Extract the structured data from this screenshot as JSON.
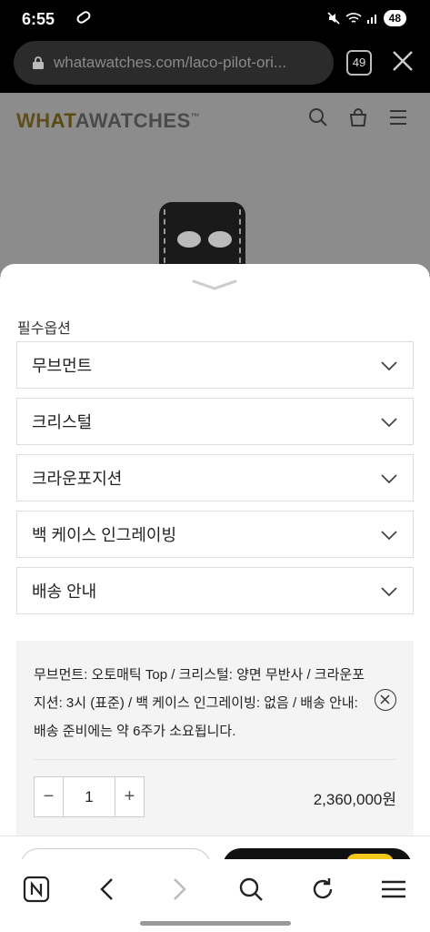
{
  "status_bar": {
    "time": "6:55",
    "battery": "48"
  },
  "browser": {
    "url": "whatawatches.com/laco-pilot-ori...",
    "tab_count": "49"
  },
  "site": {
    "logo_part1": "WH",
    "logo_part2": "AT",
    "logo_part3": "AWATCHES",
    "logo_tm": "™"
  },
  "sheet": {
    "section_label": "필수옵션",
    "options": [
      {
        "label": "무브먼트"
      },
      {
        "label": "크리스털"
      },
      {
        "label": "크라운포지션"
      },
      {
        "label": "백 케이스 인그레이빙"
      },
      {
        "label": "배송 안내"
      }
    ],
    "summary": {
      "text": "무브먼트: 오토매틱 Top / 크리스털: 양면 무반사 / 크라운포지션: 3시 (표준) / 백 케이스 인그레이빙: 없음 / 배송 안내: 배송 준비에는 약 6주가 소요됩니다.",
      "quantity": "1",
      "minus": "−",
      "plus": "+",
      "price": "2,360,000원"
    }
  },
  "colors": {
    "accent_yellow": "#f2c81d",
    "sheet_bg": "#ffffff",
    "summary_bg": "#f4f4f4"
  },
  "nav_icons": [
    "naver-icon",
    "back-icon",
    "forward-icon",
    "search-icon",
    "refresh-icon",
    "menu-icon"
  ]
}
